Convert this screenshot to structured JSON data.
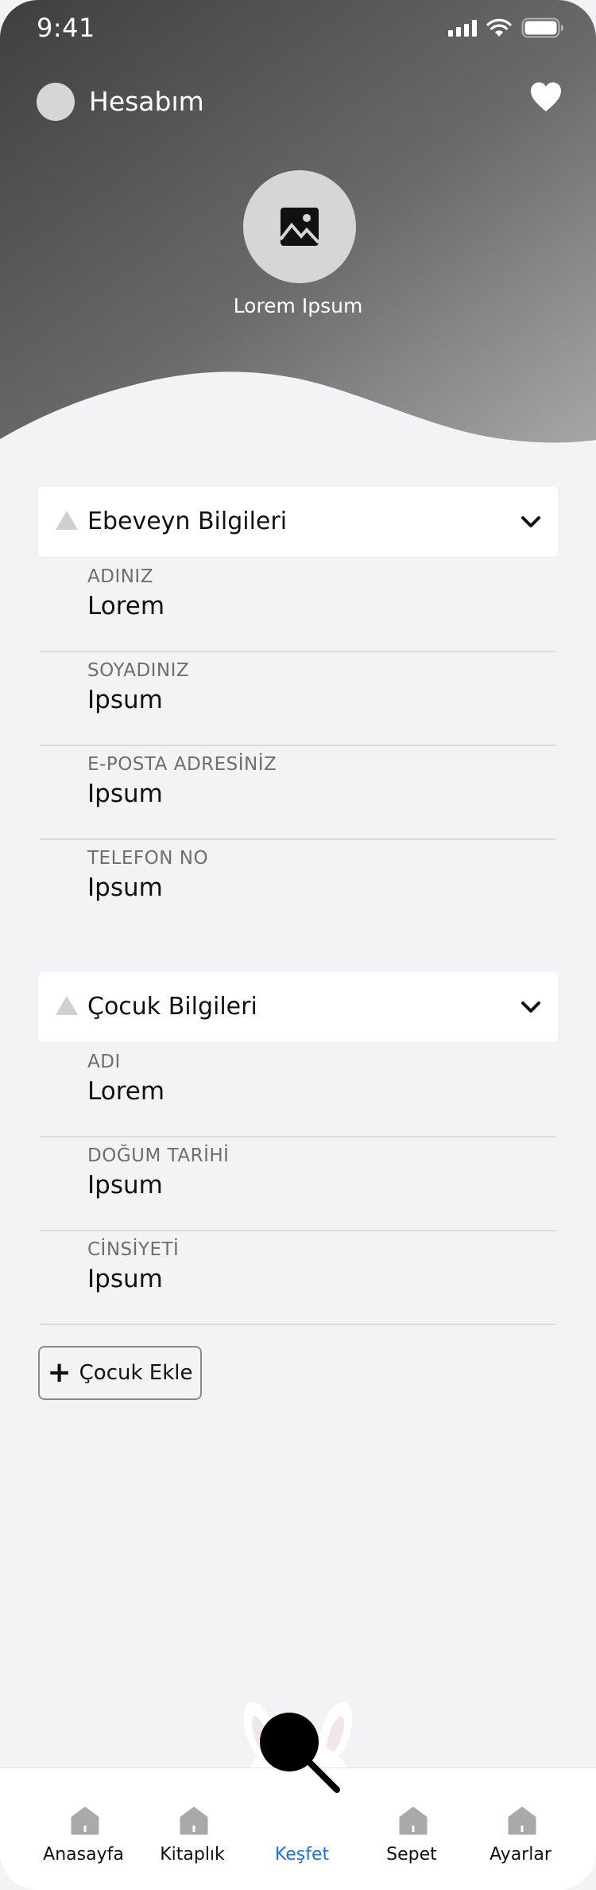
{
  "status_bar": {
    "time": "9:41"
  },
  "header": {
    "title": "Hesabım",
    "profile_name": "Lorem Ipsum"
  },
  "parent_section": {
    "title": "Ebeveyn Bilgileri",
    "fields": [
      {
        "label": "ADINIZ",
        "value": "Lorem"
      },
      {
        "label": "SOYADINIZ",
        "value": "Ipsum"
      },
      {
        "label": "E-POSTA ADRESİNİZ",
        "value": "Ipsum"
      },
      {
        "label": "TELEFON NO",
        "value": "Ipsum"
      }
    ]
  },
  "child_section": {
    "title": "Çocuk Bilgileri",
    "fields": [
      {
        "label": "ADI",
        "value": "Lorem"
      },
      {
        "label": "DOĞUM TARİHİ",
        "value": "Ipsum"
      },
      {
        "label": "CİNSİYETİ",
        "value": "Ipsum"
      }
    ],
    "add_button": "Çocuk Ekle"
  },
  "tabbar": {
    "tabs": [
      {
        "label": "Anasayfa",
        "icon": "home-icon"
      },
      {
        "label": "Kitaplık",
        "icon": "home-icon"
      },
      {
        "label": "Keşfet",
        "icon": "search-icon",
        "active": true
      },
      {
        "label": "Sepet",
        "icon": "home-icon"
      },
      {
        "label": "Ayarlar",
        "icon": "home-icon"
      }
    ]
  },
  "colors": {
    "active_tab": "#1a73e8",
    "header_dark": "#4a4a4a",
    "header_light": "#9e9e9e"
  }
}
